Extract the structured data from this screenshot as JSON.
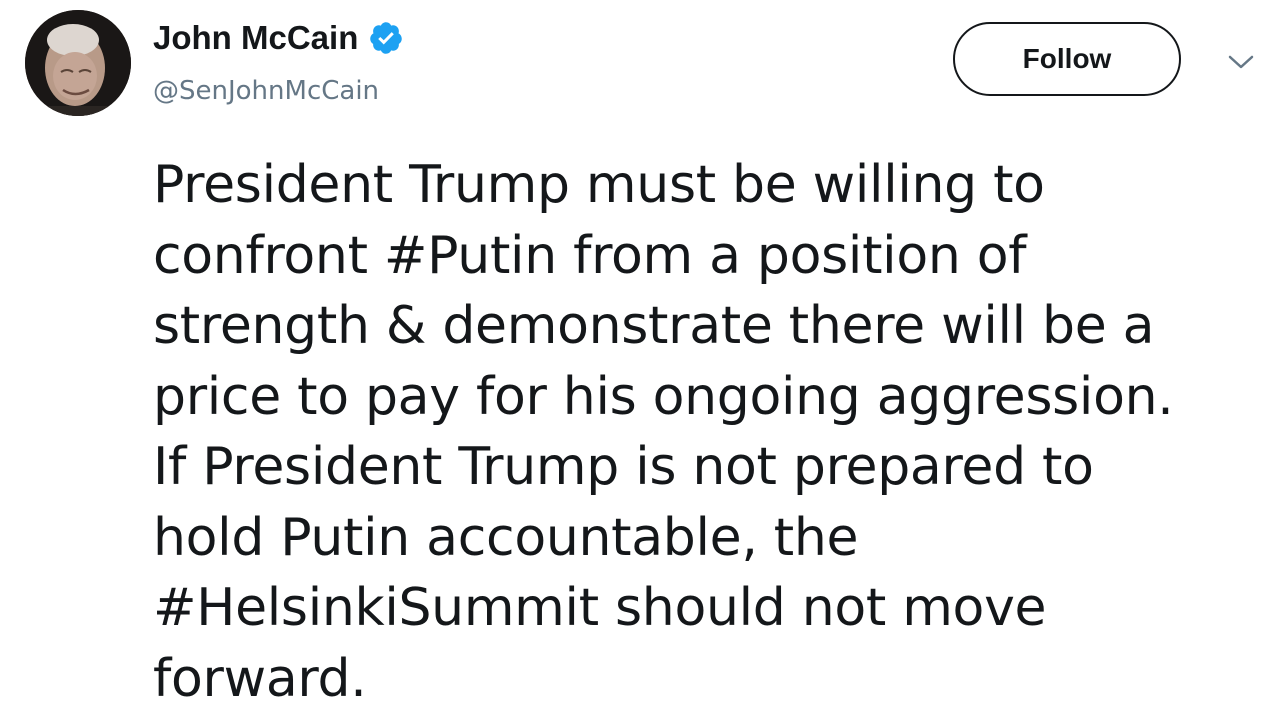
{
  "author": {
    "display_name": "John McCain",
    "handle": "@SenJohnMcCain",
    "verified_icon": "verified-badge-icon",
    "avatar_icon": "profile-photo"
  },
  "actions": {
    "follow_label": "Follow",
    "menu_icon": "chevron-down-icon"
  },
  "tweet": {
    "text": "President Trump must be willing to\nconfront #Putin from a position of\nstrength & demonstrate there will be a\nprice to pay for his ongoing aggression.\nIf President Trump is not prepared to\nhold Putin accountable, the\n#HelsinkiSummit should not move\nforward."
  },
  "colors": {
    "text": "#14171a",
    "secondary": "#657786",
    "verified": "#1da1f2"
  }
}
